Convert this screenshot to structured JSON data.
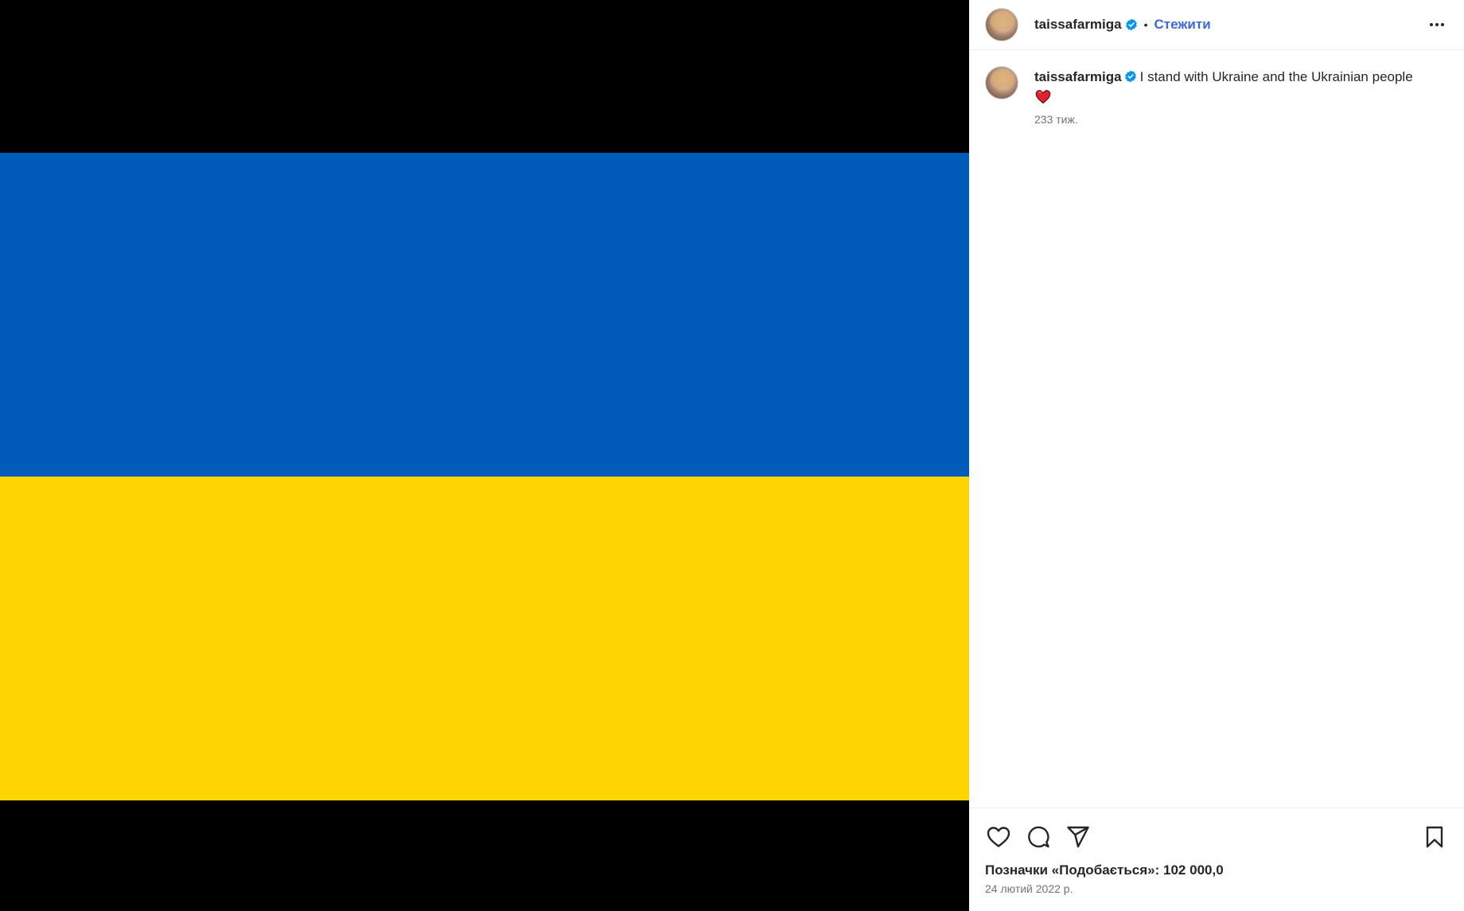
{
  "post": {
    "username": "taissafarmiga",
    "follow_label": "Стежити",
    "separator": "•",
    "flag_colors": {
      "blue": "#005bbb",
      "yellow": "#ffd500"
    }
  },
  "caption": {
    "username": "taissafarmiga",
    "text": "I stand with Ukraine and the Ukrainian people",
    "emoji": "heart-emoji",
    "time": "233 тиж."
  },
  "footer": {
    "likes": "Позначки «Подобається»: 102 000,0",
    "date": "24 лютий 2022 р."
  },
  "icons": [
    "more-options-icon",
    "verified-badge-icon",
    "heart-icon",
    "comment-icon",
    "share-icon",
    "bookmark-icon"
  ],
  "colors": {
    "link": "#3b66e6",
    "verified": "#0095f6",
    "muted": "#737373"
  }
}
